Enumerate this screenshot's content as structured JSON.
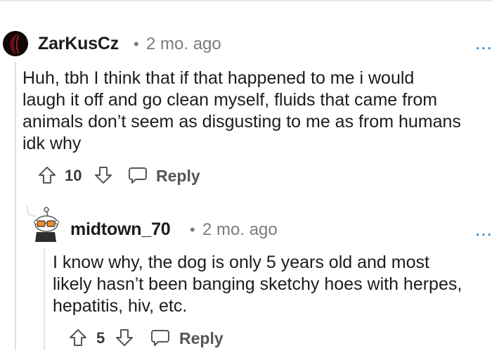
{
  "comments": [
    {
      "username": "ZarKusCz",
      "separator": "•",
      "timestamp": "2 mo. ago",
      "more": "...",
      "lines": [
        "Huh, tbh I think that if that happened to me i would",
        "laugh it off and go clean myself, fluids that came from",
        "animals don’t seem as disgusting to me as from humans",
        "idk why"
      ],
      "votes": "10",
      "reply_label": "Reply",
      "avatar_icon": "dark-avatar-icon"
    },
    {
      "username": "midtown_70",
      "separator": "•",
      "timestamp": "2 mo. ago",
      "more": "...",
      "lines": [
        "I know why, the dog is only 5 years old and most",
        "likely hasn’t been banging sketchy hoes with herpes,",
        "hepatitis, hiv, etc."
      ],
      "votes": "5",
      "reply_label": "Reply",
      "avatar_icon": "snoo-avatar-icon"
    }
  ],
  "colors": {
    "accent": "#0079d3",
    "meta_gray": "#7c7c7c",
    "text": "#1c1c1c",
    "thread_line": "#e1e1e1"
  }
}
